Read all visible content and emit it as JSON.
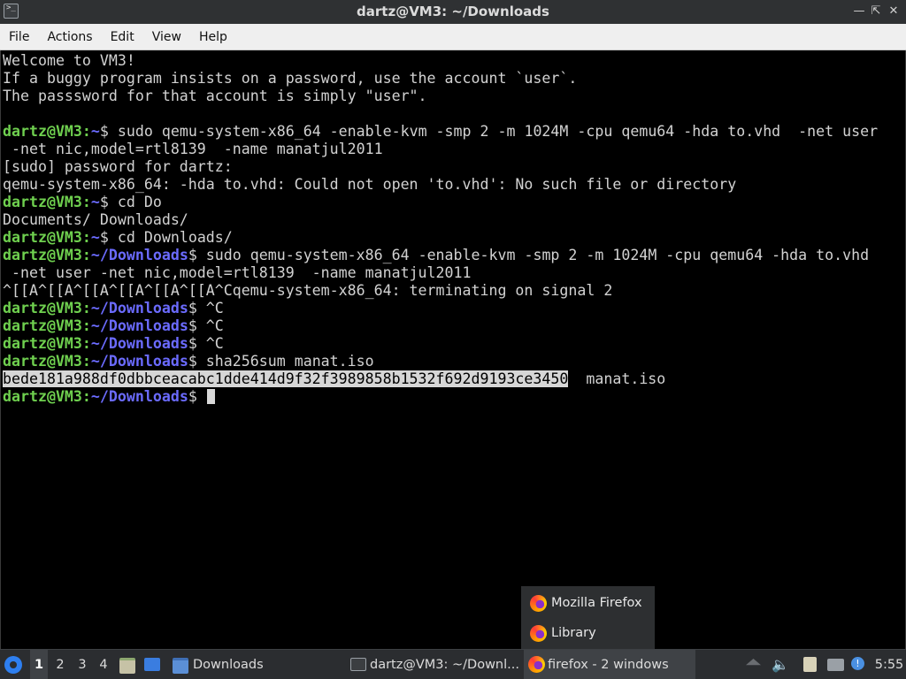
{
  "window": {
    "title": "dartz@VM3: ~/Downloads",
    "icons": {
      "app": "terminal-icon",
      "minimize": "minimize-icon",
      "maximize": "restore-icon",
      "close": "close-icon"
    }
  },
  "menubar": {
    "items": [
      "File",
      "Actions",
      "Edit",
      "View",
      "Help"
    ]
  },
  "terminal": {
    "colors": {
      "user_prompt": "#6fd04f",
      "path_prompt": "#6b6bff",
      "text": "#d2d2d2",
      "background": "#000000"
    },
    "lines": [
      [
        {
          "t": "Welcome to VM3!"
        }
      ],
      [
        {
          "t": "If a buggy program insists on a password, use the account `user`."
        }
      ],
      [
        {
          "t": "The passsword for that account is simply \"user\"."
        }
      ],
      [
        {
          "t": ""
        }
      ],
      [
        {
          "t": "dartz@VM3",
          "c": "pu"
        },
        {
          "t": ":",
          "c": "pu"
        },
        {
          "t": "~",
          "c": "pp"
        },
        {
          "t": "$ sudo qemu-system-x86_64 -enable-kvm -smp 2 -m 1024M -cpu qemu64 -hda to.vhd  -net user"
        }
      ],
      [
        {
          "t": " -net nic,model=rtl8139  -name manatjul2011"
        }
      ],
      [
        {
          "t": "[sudo] password for dartz:"
        }
      ],
      [
        {
          "t": "qemu-system-x86_64: -hda to.vhd: Could not open 'to.vhd': No such file or directory"
        }
      ],
      [
        {
          "t": "dartz@VM3",
          "c": "pu"
        },
        {
          "t": ":",
          "c": "pu"
        },
        {
          "t": "~",
          "c": "pp"
        },
        {
          "t": "$ cd Do"
        }
      ],
      [
        {
          "t": "Documents/ Downloads/"
        }
      ],
      [
        {
          "t": "dartz@VM3",
          "c": "pu"
        },
        {
          "t": ":",
          "c": "pu"
        },
        {
          "t": "~",
          "c": "pp"
        },
        {
          "t": "$ cd Downloads/"
        }
      ],
      [
        {
          "t": "dartz@VM3",
          "c": "pu"
        },
        {
          "t": ":",
          "c": "pu"
        },
        {
          "t": "~/Downloads",
          "c": "pp"
        },
        {
          "t": "$ sudo qemu-system-x86_64 -enable-kvm -smp 2 -m 1024M -cpu qemu64 -hda to.vhd"
        }
      ],
      [
        {
          "t": " -net user -net nic,model=rtl8139  -name manatjul2011"
        }
      ],
      [
        {
          "t": "^[[A^[[A^[[A^[[A^[[A^[[A^Cqemu-system-x86_64: terminating on signal 2"
        }
      ],
      [
        {
          "t": "dartz@VM3",
          "c": "pu"
        },
        {
          "t": ":",
          "c": "pu"
        },
        {
          "t": "~/Downloads",
          "c": "pp"
        },
        {
          "t": "$ ^C"
        }
      ],
      [
        {
          "t": "dartz@VM3",
          "c": "pu"
        },
        {
          "t": ":",
          "c": "pu"
        },
        {
          "t": "~/Downloads",
          "c": "pp"
        },
        {
          "t": "$ ^C"
        }
      ],
      [
        {
          "t": "dartz@VM3",
          "c": "pu"
        },
        {
          "t": ":",
          "c": "pu"
        },
        {
          "t": "~/Downloads",
          "c": "pp"
        },
        {
          "t": "$ ^C"
        }
      ],
      [
        {
          "t": "dartz@VM3",
          "c": "pu"
        },
        {
          "t": ":",
          "c": "pu"
        },
        {
          "t": "~/Downloads",
          "c": "pp"
        },
        {
          "t": "$ sha256sum manat.iso"
        }
      ],
      [
        {
          "t": "bede181a988df0dbbceacabc1dde414d9f32f3989858b1532f692d9193ce3450",
          "c": "sel"
        },
        {
          "t": "  manat.iso"
        }
      ],
      [
        {
          "t": "dartz@VM3",
          "c": "pu"
        },
        {
          "t": ":",
          "c": "pu"
        },
        {
          "t": "~/Downloads",
          "c": "pp"
        },
        {
          "t": "$ "
        },
        {
          "cursor": true
        }
      ]
    ]
  },
  "firefox_popup": {
    "items": [
      {
        "label": "Mozilla Firefox",
        "icon": "firefox-icon"
      },
      {
        "label": "Library",
        "icon": "firefox-icon"
      }
    ]
  },
  "taskbar": {
    "menu_icon": "lxqt-menu-icon",
    "workspaces": [
      "1",
      "2",
      "3",
      "4"
    ],
    "active_workspace": "1",
    "quicklaunch": [
      {
        "name": "file-manager-launcher-icon"
      },
      {
        "name": "show-desktop-icon"
      }
    ],
    "tasks": [
      {
        "label": "Downloads",
        "icon": "folder-icon"
      },
      {
        "label": "dartz@VM3: ~/Downl...",
        "icon": "terminal-icon"
      },
      {
        "label": "firefox - 2 windows",
        "icon": "firefox-icon"
      }
    ],
    "tray": [
      "eject-icon",
      "volume-icon",
      "clipboard-icon",
      "network-icon",
      "notification-icon"
    ],
    "clock": "5:55"
  }
}
